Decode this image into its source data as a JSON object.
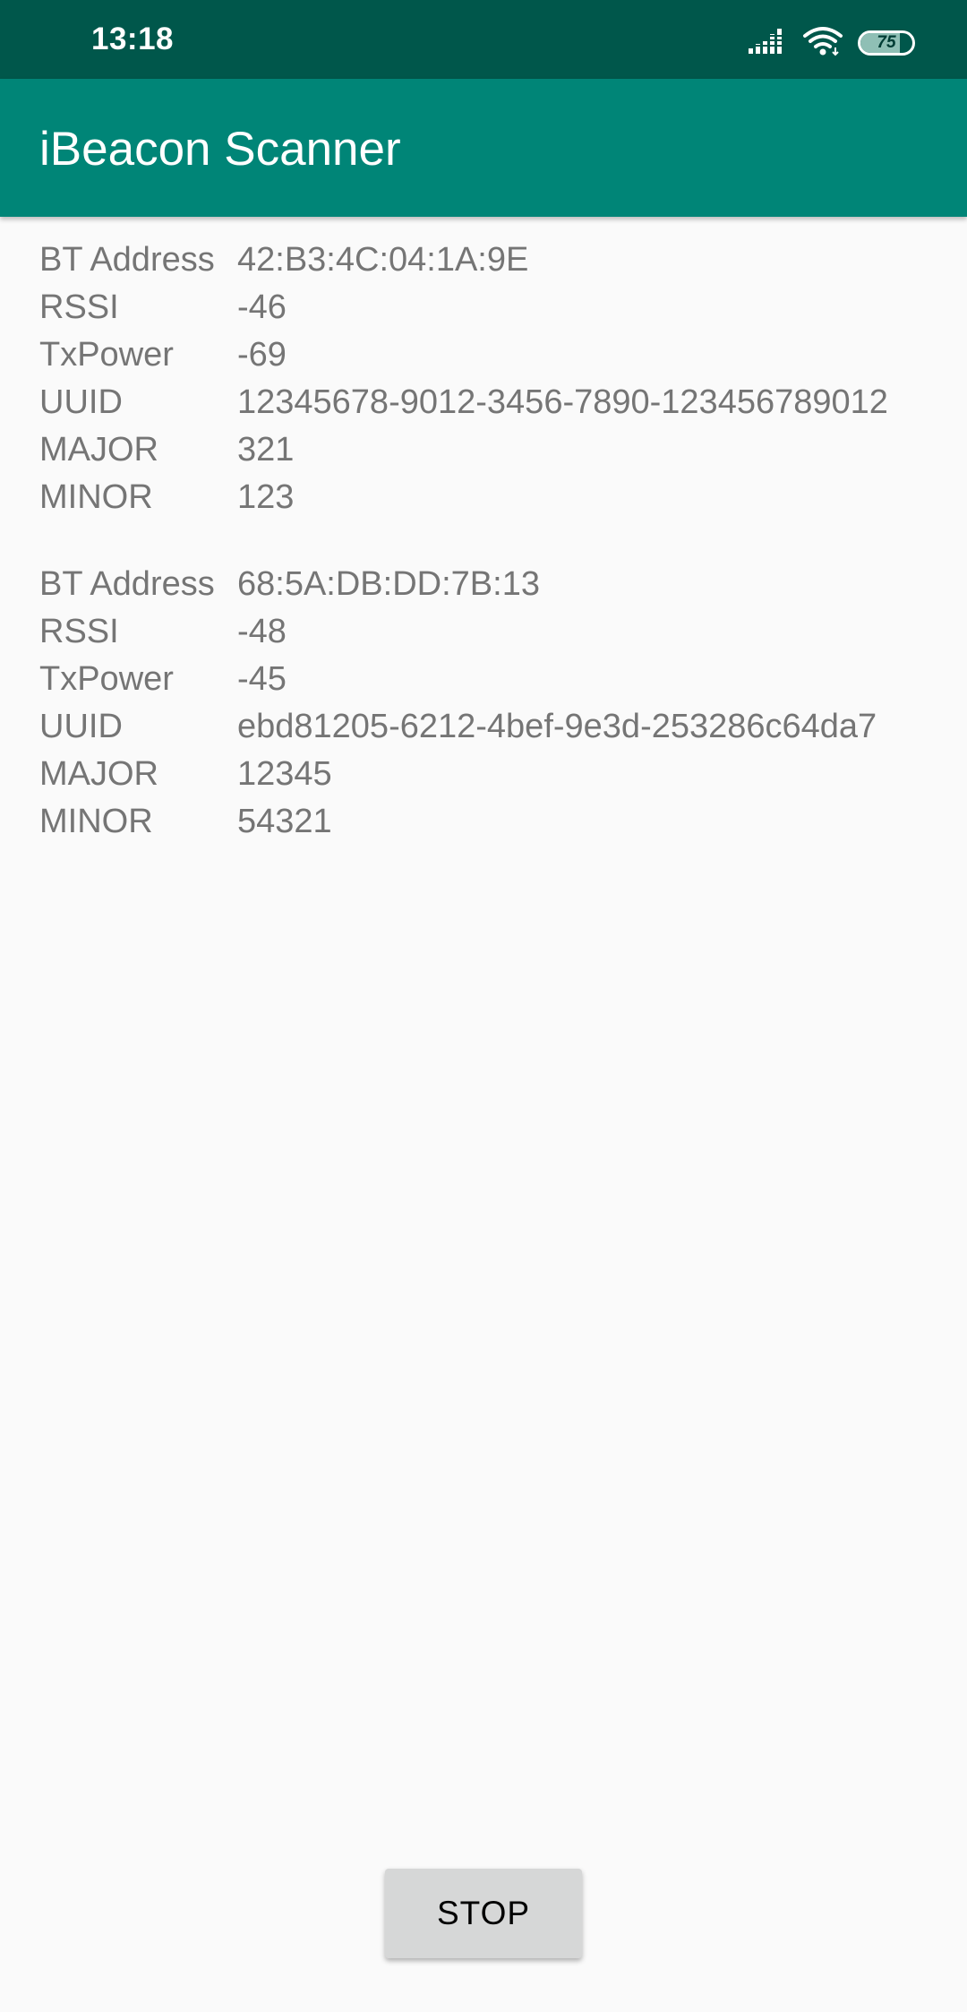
{
  "status_bar": {
    "time": "13:18",
    "battery_level": "75",
    "battery_fraction": 0.75,
    "icons": [
      "signal-icon",
      "wifi-icon",
      "battery-icon"
    ]
  },
  "app_bar": {
    "title": "iBeacon Scanner"
  },
  "beacons": [
    {
      "rows": [
        {
          "label": "BT Address",
          "value": "42:B3:4C:04:1A:9E"
        },
        {
          "label": "RSSI",
          "value": "-46"
        },
        {
          "label": "TxPower",
          "value": "-69"
        },
        {
          "label": "UUID",
          "value": "12345678-9012-3456-7890-123456789012"
        },
        {
          "label": "MAJOR",
          "value": "321"
        },
        {
          "label": "MINOR",
          "value": "123"
        }
      ]
    },
    {
      "rows": [
        {
          "label": "BT Address",
          "value": "68:5A:DB:DD:7B:13"
        },
        {
          "label": "RSSI",
          "value": "-48"
        },
        {
          "label": "TxPower",
          "value": "-45"
        },
        {
          "label": "UUID",
          "value": "ebd81205-6212-4bef-9e3d-253286c64da7"
        },
        {
          "label": "MAJOR",
          "value": "12345"
        },
        {
          "label": "MINOR",
          "value": "54321"
        }
      ]
    }
  ],
  "actions": {
    "stop_label": "STOP"
  },
  "colors": {
    "status_bar": "#00574b",
    "app_bar": "#008577",
    "background": "#fafafa",
    "text_secondary": "#757575",
    "button": "#d6d7d7"
  }
}
